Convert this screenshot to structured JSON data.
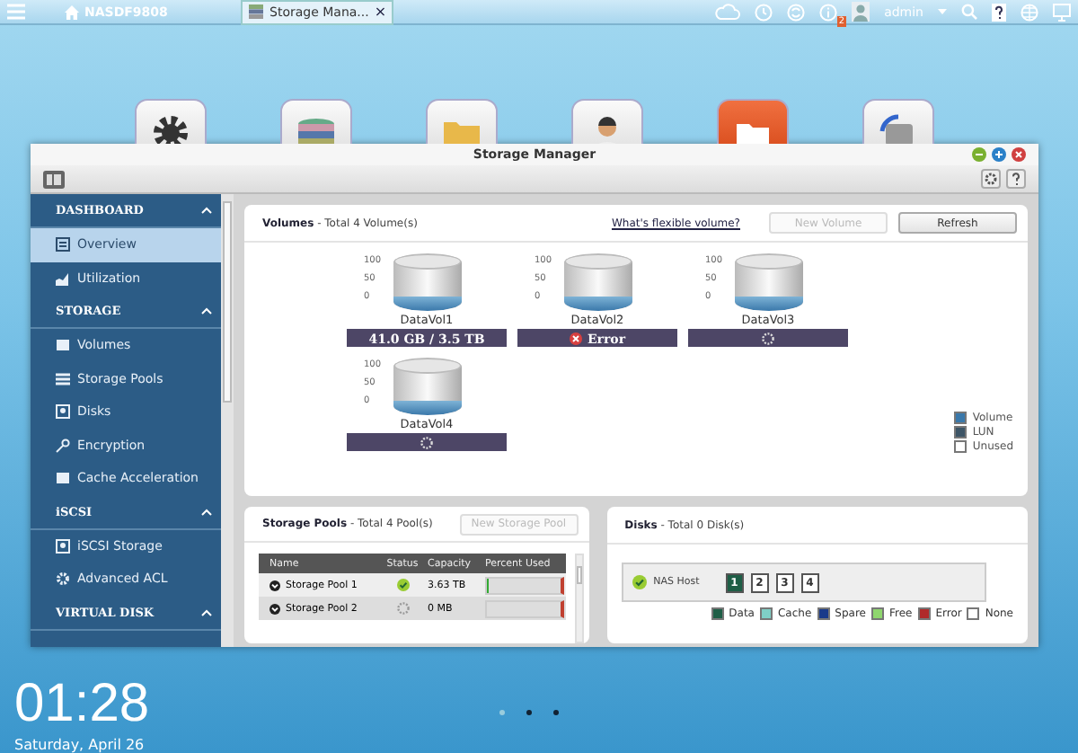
{
  "taskbar": {
    "host": "NASDF9808",
    "tab": "Storage Mana...",
    "tab_close": "×",
    "notification_count": "2",
    "user": "admin"
  },
  "desktop_apps": [
    {
      "kind": "gear"
    },
    {
      "kind": "disks"
    },
    {
      "kind": "shared-folder"
    },
    {
      "kind": "person"
    },
    {
      "kind": "folder"
    },
    {
      "kind": "backup"
    }
  ],
  "window": {
    "title": "Storage Manager"
  },
  "sidebar": {
    "sections": [
      {
        "title": "DASHBOARD",
        "expanded": true,
        "items": [
          {
            "label": "Overview",
            "kind": "overview",
            "selected": true
          },
          {
            "label": "Utilization",
            "kind": "chart",
            "selected": false
          }
        ]
      },
      {
        "title": "STORAGE",
        "expanded": true,
        "items": [
          {
            "label": "Volumes",
            "kind": "drive",
            "selected": false
          },
          {
            "label": "Storage Pools",
            "kind": "stack",
            "selected": false
          },
          {
            "label": "Disks",
            "kind": "disk",
            "selected": false
          },
          {
            "label": "Encryption",
            "kind": "key",
            "selected": false
          },
          {
            "label": "Cache Acceleration",
            "kind": "drive",
            "selected": false
          }
        ]
      },
      {
        "title": "iSCSI",
        "expanded": true,
        "items": [
          {
            "label": "iSCSI Storage",
            "kind": "disk",
            "selected": false
          },
          {
            "label": "Advanced ACL",
            "kind": "gear",
            "selected": false
          }
        ]
      },
      {
        "title": "VIRTUAL DISK",
        "expanded": true
      }
    ]
  },
  "volumes": {
    "title": "Volumes",
    "summary": "- Total 4 Volume(s)",
    "link": "What's flexible volume?",
    "new_button": {
      "label": "New Volume",
      "disabled": true
    },
    "refresh_button": "Refresh",
    "items": [
      {
        "name": "DataVol1",
        "ticks": [
          "100",
          "50",
          "0"
        ],
        "kind": "capacity",
        "status": "41.0 GB / 3.5 TB"
      },
      {
        "name": "DataVol2",
        "ticks": [
          "100",
          "50",
          "0"
        ],
        "kind": "error",
        "status": "Error"
      },
      {
        "name": "DataVol3",
        "ticks": [
          "100",
          "50",
          "0"
        ],
        "kind": "loading"
      },
      {
        "name": "DataVol4",
        "ticks": [
          "100",
          "50",
          "0"
        ],
        "kind": "loading"
      }
    ],
    "legend": [
      {
        "label": "Volume",
        "color": "#3a78aa"
      },
      {
        "label": "LUN",
        "color": "#3d5566"
      },
      {
        "label": "Unused",
        "color": "#ffffff"
      }
    ]
  },
  "pools": {
    "title": "Storage Pools",
    "summary": "- Total 4 Pool(s)",
    "new_button": {
      "label": "New Storage Pool",
      "disabled": true
    },
    "columns": [
      "Name",
      "Status",
      "Capacity",
      "Percent Used"
    ],
    "rows": [
      {
        "name": "Storage Pool 1",
        "kind": "ok",
        "capacity": "3.63 TB",
        "level": 0.02
      },
      {
        "name": "Storage Pool 2",
        "kind": "loading",
        "capacity": "0 MB",
        "level": 0
      }
    ]
  },
  "disks": {
    "title": "Disks",
    "summary": "- Total 0 Disk(s)",
    "host": "NAS Host",
    "slots": [
      {
        "label": "1",
        "color": "#1e5e46"
      },
      {
        "label": "2",
        "color": "#ffffff"
      },
      {
        "label": "3",
        "color": "#ffffff"
      },
      {
        "label": "4",
        "color": "#ffffff"
      }
    ],
    "legend": [
      {
        "label": "Data",
        "color": "#1e5e46"
      },
      {
        "label": "Cache",
        "color": "#7fcfc6"
      },
      {
        "label": "Spare",
        "color": "#1a3a8a"
      },
      {
        "label": "Free",
        "color": "#8fd66e"
      },
      {
        "label": "Error",
        "color": "#b02a2a"
      },
      {
        "label": "None",
        "color": "#ffffff"
      }
    ]
  },
  "desktop": {
    "clock": "01:28",
    "date": "Saturday, April 26",
    "pages": [
      {
        "selected": true
      },
      {
        "selected": false
      },
      {
        "selected": false
      }
    ]
  }
}
